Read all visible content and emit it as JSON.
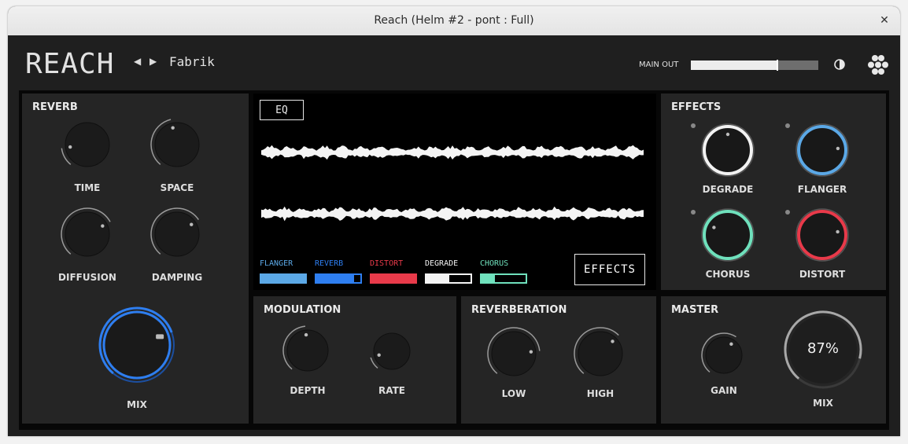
{
  "window": {
    "title": "Reach (Helm #2 - pont : Full)",
    "close_glyph": "✕"
  },
  "header": {
    "logo": "REACH",
    "nav_prev": "◀",
    "nav_next": "▶",
    "preset_name": "Fabrik",
    "main_out_label": "MAIN OUT",
    "main_out_level": 0.68,
    "icons": {
      "contrast": "contrast-icon",
      "menu": "hexagon-menu-icon"
    }
  },
  "reverb": {
    "title": "REVERB",
    "knobs": [
      {
        "label": "TIME",
        "value": 0.15
      },
      {
        "label": "SPACE",
        "value": 0.45
      },
      {
        "label": "DIFFUSION",
        "value": 0.72
      },
      {
        "label": "DAMPING",
        "value": 0.7
      }
    ],
    "mix": {
      "label": "MIX",
      "value": 0.75,
      "color": "#2e7ef0"
    }
  },
  "display": {
    "eq_button": "EQ",
    "effects_button": "EFFECTS",
    "legend": [
      {
        "label": "FLANGER",
        "color": "#5ba8e6",
        "value": 1.0
      },
      {
        "label": "REVERB",
        "color": "#2e7ef0",
        "value": 0.85
      },
      {
        "label": "DISTORT",
        "color": "#e83a4a",
        "value": 1.0
      },
      {
        "label": "DEGRADE",
        "color": "#f2f2f2",
        "value": 0.52
      },
      {
        "label": "CHORUS",
        "color": "#6fe0bc",
        "value": 0.3
      }
    ]
  },
  "modulation": {
    "title": "MODULATION",
    "knobs": [
      {
        "label": "DEPTH",
        "value": 0.48
      },
      {
        "label": "RATE",
        "value": 0.12
      }
    ]
  },
  "reverberation": {
    "title": "REVERBERATION",
    "knobs": [
      {
        "label": "LOW",
        "value": 0.8
      },
      {
        "label": "HIGH",
        "value": 0.66
      }
    ]
  },
  "effects": {
    "title": "EFFECTS",
    "knobs": [
      {
        "label": "DEGRADE",
        "value": 0.5,
        "color": "#f2f2f2"
      },
      {
        "label": "FLANGER",
        "value": 0.8,
        "color": "#5ba8e6"
      },
      {
        "label": "CHORUS",
        "value": 0.28,
        "color": "#6fe0bc"
      },
      {
        "label": "DISTORT",
        "value": 0.78,
        "color": "#e83a4a"
      }
    ]
  },
  "master": {
    "title": "MASTER",
    "gain": {
      "label": "GAIN",
      "value": 0.62
    },
    "mix": {
      "label": "MIX",
      "value": 0.87,
      "display": "87%"
    }
  }
}
